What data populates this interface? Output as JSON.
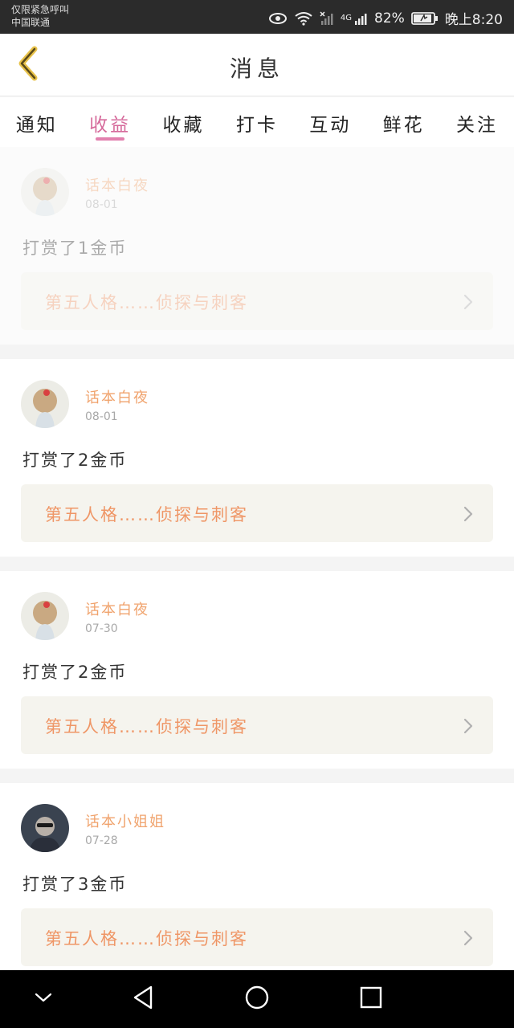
{
  "status_bar": {
    "emergency_text": "仅限紧急呼叫",
    "carrier": "中国联通",
    "network": "4G",
    "battery": "82%",
    "time": "晚上8:20"
  },
  "header": {
    "title": "消息",
    "back_icon": "chevron-left-icon"
  },
  "tabs": [
    {
      "label": "通知",
      "active": false
    },
    {
      "label": "收益",
      "active": true
    },
    {
      "label": "收藏",
      "active": false
    },
    {
      "label": "打卡",
      "active": false
    },
    {
      "label": "互动",
      "active": false
    },
    {
      "label": "鲜花",
      "active": false
    },
    {
      "label": "关注",
      "active": false
    }
  ],
  "feed": [
    {
      "username": "话本白夜",
      "date": "08-01",
      "message": "打赏了1金币",
      "link": "第五人格……侦探与刺客",
      "dim": true
    },
    {
      "username": "话本白夜",
      "date": "08-01",
      "message": "打赏了2金币",
      "link": "第五人格……侦探与刺客",
      "dim": false
    },
    {
      "username": "话本白夜",
      "date": "07-30",
      "message": "打赏了2金币",
      "link": "第五人格……侦探与刺客",
      "dim": false
    },
    {
      "username": "话本小姐姐",
      "date": "07-28",
      "message": "打赏了3金币",
      "link": "第五人格……侦探与刺客",
      "dim": false
    }
  ],
  "colors": {
    "accent_pink": "#e280ae",
    "username_orange": "#f0a36d",
    "link_orange": "#ef9666",
    "link_bg": "#f5f4ee"
  },
  "nav_bar": {
    "icons": [
      "chevron-down-icon",
      "back-triangle-icon",
      "home-circle-icon",
      "recents-square-icon"
    ]
  }
}
